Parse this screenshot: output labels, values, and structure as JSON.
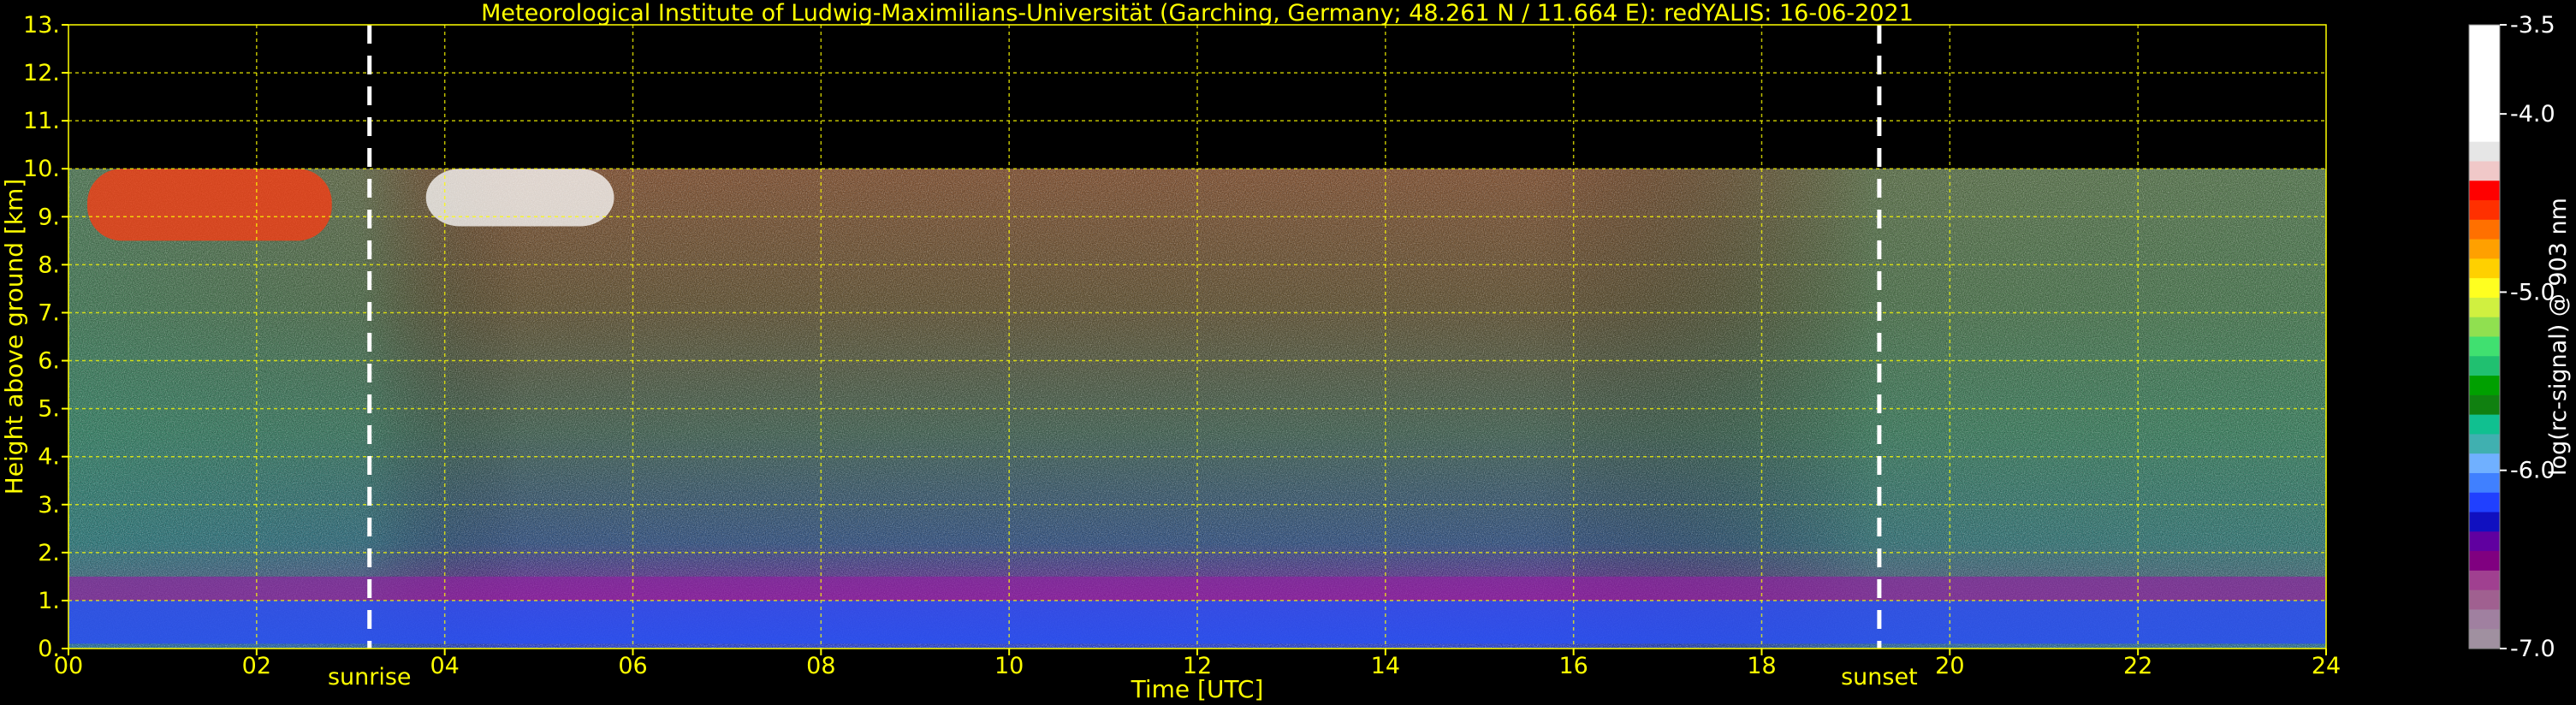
{
  "chart_data": {
    "type": "heatmap",
    "title": "Meteorological Institute of Ludwig-Maximilians-Universität (Garching, Germany; 48.261 N / 11.664 E):    redYALIS: 16-06-2021",
    "xlabel": "Time [UTC]",
    "ylabel": "Height above ground [km]",
    "xlim": [
      0,
      24
    ],
    "ylim": [
      0,
      13
    ],
    "x_ticks": [
      "00",
      "02",
      "04",
      "06",
      "08",
      "10",
      "12",
      "14",
      "16",
      "18",
      "20",
      "22",
      "24"
    ],
    "y_ticks": [
      "0.",
      "1.",
      "2.",
      "3.",
      "4.",
      "5.",
      "6.",
      "7.",
      "8.",
      "9.",
      "10.",
      "11.",
      "12.",
      "13."
    ],
    "grid": true,
    "grid_color": "#ffff00",
    "data_max_height_km": 10,
    "sunrise": {
      "x": 3.2,
      "label": "sunrise"
    },
    "sunset": {
      "x": 19.25,
      "label": "sunset"
    },
    "colorbar": {
      "label": "log(rc-signal) @ 903 nm",
      "range": [
        -7.0,
        -3.5
      ],
      "ticks": [
        "-3.5",
        "-4.0",
        "-5.0",
        "-6.0",
        "-7.0"
      ],
      "tick_values": [
        -3.5,
        -4.0,
        -5.0,
        -6.0,
        -7.0
      ],
      "colors": [
        "#ffffff",
        "#ffffff",
        "#ffffff",
        "#ffffff",
        "#ffffff",
        "#ffffff",
        "#e6e6e6",
        "#f0c8c8",
        "#ff0000",
        "#ff3000",
        "#ff7000",
        "#ffa000",
        "#ffd000",
        "#ffff20",
        "#d0f040",
        "#90e050",
        "#40e070",
        "#20c070",
        "#00a000",
        "#108010",
        "#10c090",
        "#40b0b0",
        "#70b0ff",
        "#4080ff",
        "#2040ff",
        "#1010c0",
        "#6000a0",
        "#800080",
        "#a04090",
        "#a06090",
        "#a080a0",
        "#a090a0"
      ]
    },
    "layers": [
      {
        "name": "boundary layer",
        "height_km": [
          0.1,
          1.0
        ]
      },
      {
        "name": "residual layer",
        "height_km": [
          1.0,
          1.5
        ]
      },
      {
        "name": "cirrus",
        "time_utc": [
          0.2,
          2.8
        ],
        "height_km": [
          8.5,
          10.0
        ]
      },
      {
        "name": "cirrus",
        "time_utc": [
          3.8,
          5.8
        ],
        "height_km": [
          8.8,
          10.0
        ]
      }
    ]
  }
}
